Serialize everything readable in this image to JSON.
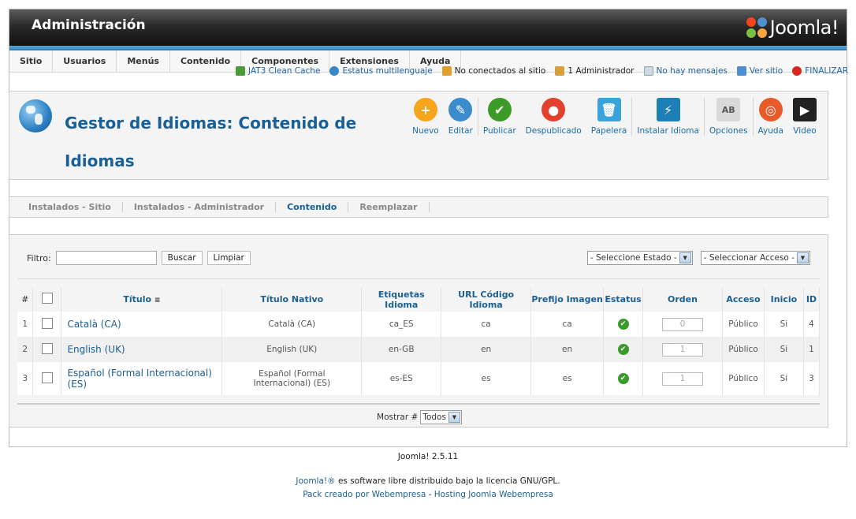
{
  "header": {
    "title": "Administración",
    "logo_text": "Joomla!"
  },
  "menu": [
    "Sitio",
    "Usuarios",
    "Menús",
    "Contenido",
    "Componentes",
    "Extensiones",
    "Ayuda"
  ],
  "status": [
    {
      "label": "JAT3 Clean Cache",
      "icon": "cache-icon"
    },
    {
      "label": "Estatus multilenguaje",
      "icon": "globe-icon"
    },
    {
      "label": "No conectados al sitio",
      "icon": "users-icon"
    },
    {
      "label": "1 Administrador",
      "icon": "admin-icon"
    },
    {
      "label": "No hay mensajes",
      "icon": "mail-icon"
    },
    {
      "label": "Ver sitio",
      "icon": "monitor-icon"
    },
    {
      "label": "FINALIZAR",
      "icon": "logout-icon"
    }
  ],
  "page": {
    "title": "Gestor de Idiomas: Contenido de Idiomas"
  },
  "toolbar": {
    "nuevo": "Nuevo",
    "editar": "Editar",
    "publicar": "Publicar",
    "despublicado": "Despublicado",
    "papelera": "Papelera",
    "instalar": "Instalar Idioma",
    "opciones": "Opciones",
    "ayuda": "Ayuda",
    "video": "Video"
  },
  "subnav": [
    "Instalados - Sitio",
    "Instalados - Administrador",
    "Contenido",
    "Reemplazar"
  ],
  "filter": {
    "label": "Filtro:",
    "value": "",
    "buscar": "Buscar",
    "limpiar": "Limpiar",
    "estado": "- Seleccione Estado -",
    "acceso": "- Seleccionar Acceso -"
  },
  "table": {
    "headers": [
      "#",
      "Título",
      "Título Nativo",
      "Etiquetas Idioma",
      "URL Código Idioma",
      "Prefijo Imagen",
      "Estatus",
      "Orden",
      "Acceso",
      "Inicio",
      "ID"
    ],
    "rows": [
      {
        "num": "1",
        "title": "Català (CA)",
        "native": "Català (CA)",
        "tag": "ca_ES",
        "url": "ca",
        "prefix": "ca",
        "order": "0",
        "access": "Público",
        "home": "Si",
        "id": "4"
      },
      {
        "num": "2",
        "title": "English (UK)",
        "native": "English (UK)",
        "tag": "en-GB",
        "url": "en",
        "prefix": "en",
        "order": "1",
        "access": "Público",
        "home": "Si",
        "id": "1"
      },
      {
        "num": "3",
        "title": "Español (Formal Internacional) (ES)",
        "native": "Español (Formal Internacional) (ES)",
        "tag": "es-ES",
        "url": "es",
        "prefix": "es",
        "order": "1",
        "access": "Público",
        "home": "Si",
        "id": "3"
      }
    ]
  },
  "pagination": {
    "label": "Mostrar #",
    "value": "Todos"
  },
  "footer": {
    "version": "Joomla! 2.5.11",
    "joomla_link": "Joomla!®",
    "license": " es software libre distribuido bajo la licencia GNU/GPL.",
    "pack": "Pack creado por Webempresa",
    "dash": " - ",
    "hosting": "Hosting Joomla Webempresa"
  }
}
